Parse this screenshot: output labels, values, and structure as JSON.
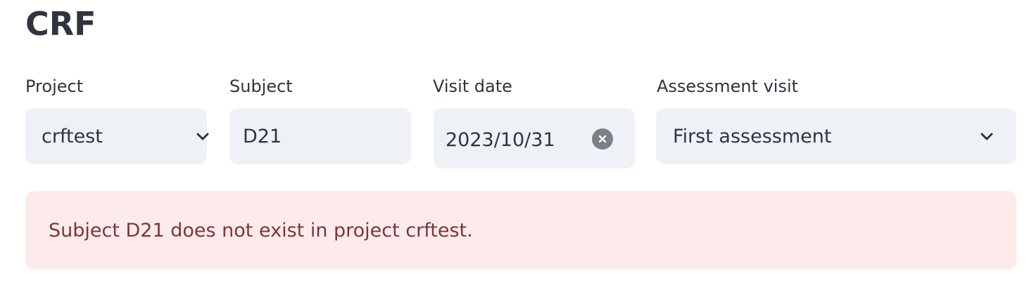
{
  "page": {
    "title": "CRF"
  },
  "form": {
    "project": {
      "label": "Project",
      "value": "crftest",
      "icon": "chevron-down-icon"
    },
    "subject": {
      "label": "Subject",
      "value": "D21"
    },
    "visit_date": {
      "label": "Visit date",
      "value": "2023/10/31",
      "icon": "clear-icon"
    },
    "assessment_visit": {
      "label": "Assessment visit",
      "value": "First assessment",
      "icon": "chevron-down-icon"
    }
  },
  "alert": {
    "message": "Subject D21 does not exist in project crftest.",
    "background_color": "#fcebea",
    "text_color": "#7d353b"
  },
  "colors": {
    "field_background": "#eef2f6",
    "text": "#31333f"
  }
}
